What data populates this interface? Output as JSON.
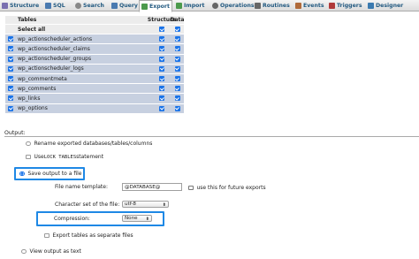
{
  "tabs": [
    {
      "label": "Structure",
      "icon": "structure-icon",
      "color": "#7a6fb0"
    },
    {
      "label": "SQL",
      "icon": "sql-icon",
      "color": "#4a7ab0"
    },
    {
      "label": "Search",
      "icon": "search-icon",
      "color": "#888888"
    },
    {
      "label": "Query",
      "icon": "query-icon",
      "color": "#4a7ab0"
    },
    {
      "label": "Export",
      "icon": "export-icon",
      "color": "#4c9a4c"
    },
    {
      "label": "Import",
      "icon": "import-icon",
      "color": "#4c9a4c"
    },
    {
      "label": "Operations",
      "icon": "operations-icon",
      "color": "#666666"
    },
    {
      "label": "Routines",
      "icon": "routines-icon",
      "color": "#666666"
    },
    {
      "label": "Events",
      "icon": "events-icon",
      "color": "#b06a3a"
    },
    {
      "label": "Triggers",
      "icon": "triggers-icon",
      "color": "#b03a3a"
    },
    {
      "label": "Designer",
      "icon": "designer-icon",
      "color": "#3a7ab0"
    }
  ],
  "active_tab": "Export",
  "table_list": {
    "headers": {
      "tables": "Tables",
      "structure": "Structure",
      "data": "Data"
    },
    "select_all": "Select all",
    "rows": [
      "wp_actionscheduler_actions",
      "wp_actionscheduler_claims",
      "wp_actionscheduler_groups",
      "wp_actionscheduler_logs",
      "wp_commentmeta",
      "wp_comments",
      "wp_links",
      "wp_options"
    ]
  },
  "output": {
    "legend": "Output:",
    "rename_label": "Rename exported databases/tables/columns",
    "use_prefix": "Use ",
    "lock_tables_code": "LOCK TABLES",
    "use_suffix": " statement",
    "save_label": "Save output to a file",
    "file_name_label": "File name template:",
    "file_name_value": "@DATABASE@",
    "future_label": "use this for future exports",
    "charset_label": "Character set of the file:",
    "charset_value": "utf-8",
    "compression_label": "Compression:",
    "compression_value": "None",
    "separate_label": "Export tables as separate files",
    "view_text_label": "View output as text"
  },
  "colors": {
    "highlight": "#1e88e5",
    "selected_row": "#c7d0e0",
    "checkbox": "#1a73e8"
  }
}
